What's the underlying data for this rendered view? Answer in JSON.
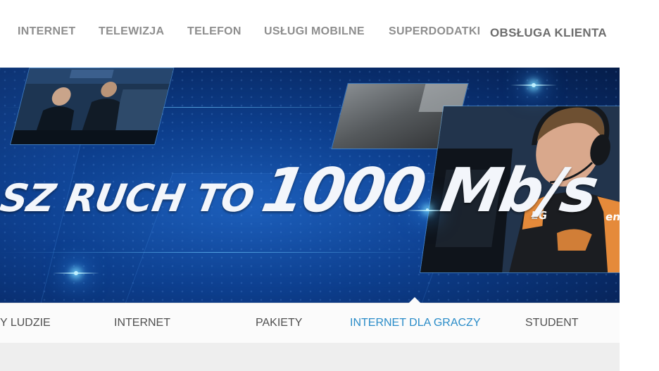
{
  "top_nav": {
    "items": [
      "INTERNET",
      "TELEWIZJA",
      "TELEFON",
      "USŁUGI MOBILNE",
      "SUPERDODATKI"
    ],
    "customer_service": "OBSŁUGA KLIENTA"
  },
  "banner": {
    "headline_part1": "SZ RUCH TO",
    "headline_part2": "1000 Mb/s",
    "jersey_text_left": "EG",
    "jersey_text_right": "eno"
  },
  "sub_nav": {
    "tabs": [
      "Y LUDZIE",
      "INTERNET",
      "PAKIETY",
      "INTERNET DLA GRACZY",
      "STUDENT"
    ],
    "active_tab": "INTERNET DLA GRACZY"
  },
  "colors": {
    "nav_text": "#8e8e8e",
    "active_tab": "#2a8cc8",
    "banner_blue": "#0d3f8e"
  }
}
